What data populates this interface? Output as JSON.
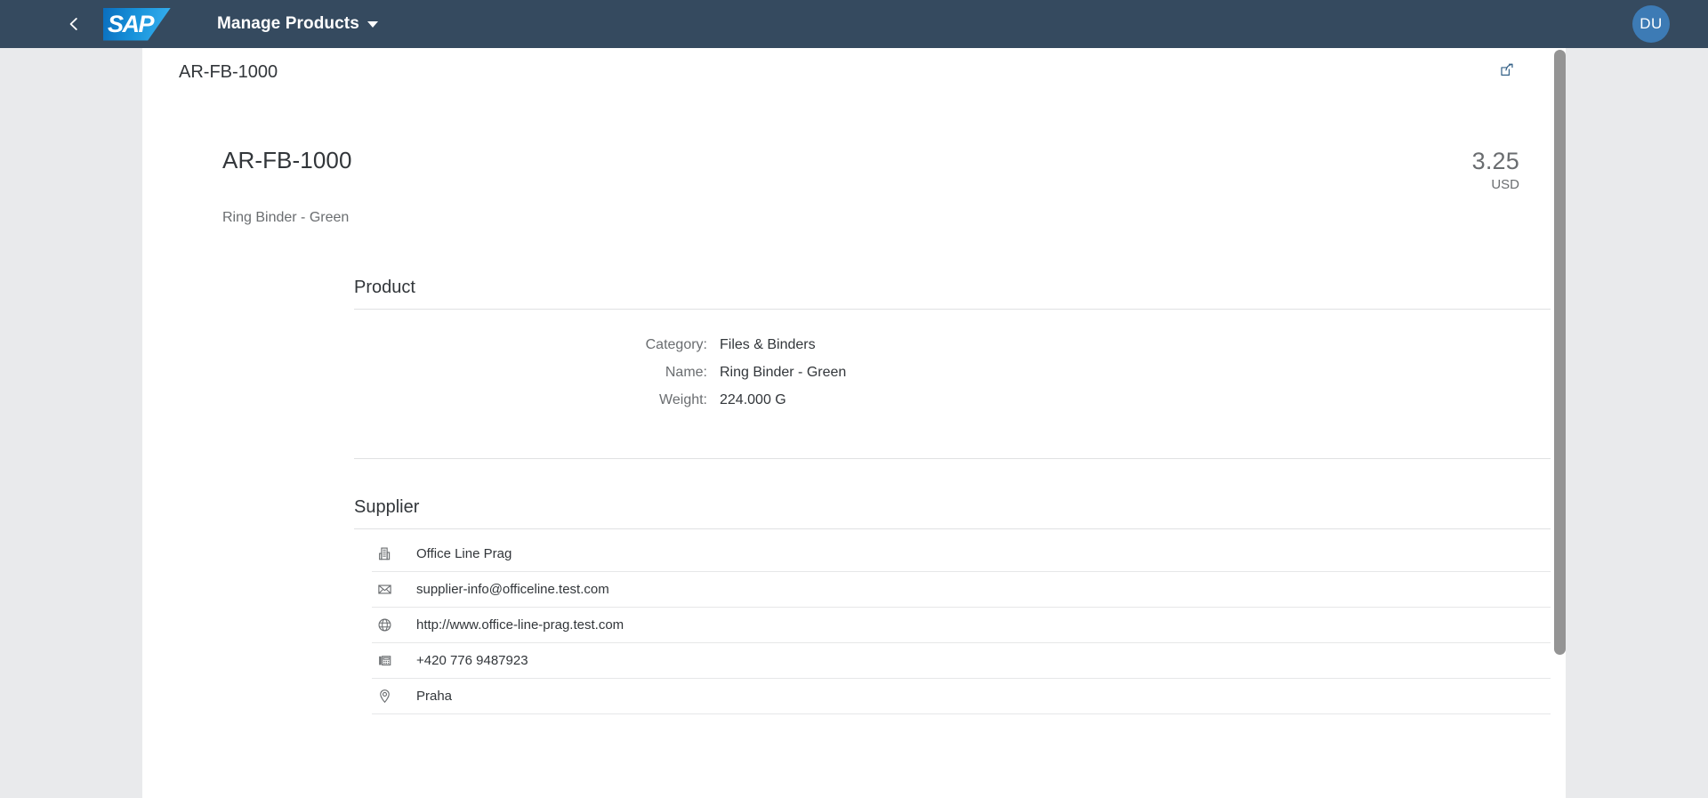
{
  "shellbar": {
    "back_icon": "chevron-left-icon",
    "logo_text": "SAP",
    "app_title": "Manage Products",
    "dropdown_icon": "caret-down-icon",
    "avatar_initials": "DU",
    "background_color": "#354a5f",
    "avatar_color": "#3d7bb5"
  },
  "page": {
    "header_title": "AR-FB-1000",
    "share_icon": "share-export-icon",
    "share_icon_color": "#346187"
  },
  "object_header": {
    "title": "AR-FB-1000",
    "subtitle": "Ring Binder - Green",
    "price": "3.25",
    "currency": "USD"
  },
  "product_section": {
    "heading": "Product",
    "fields": [
      {
        "label": "Category:",
        "value": "Files & Binders"
      },
      {
        "label": "Name:",
        "value": "Ring Binder - Green"
      },
      {
        "label": "Weight:",
        "value": "224.000 G"
      }
    ]
  },
  "supplier_section": {
    "heading": "Supplier",
    "rows": [
      {
        "icon": "building-icon",
        "value": "Office Line Prag"
      },
      {
        "icon": "email-icon",
        "value": "supplier-info@officeline.test.com"
      },
      {
        "icon": "globe-icon",
        "value": "http://www.office-line-prag.test.com"
      },
      {
        "icon": "fax-icon",
        "value": "+420 776 9487923"
      },
      {
        "icon": "map-pin-icon",
        "value": "Praha"
      }
    ]
  }
}
